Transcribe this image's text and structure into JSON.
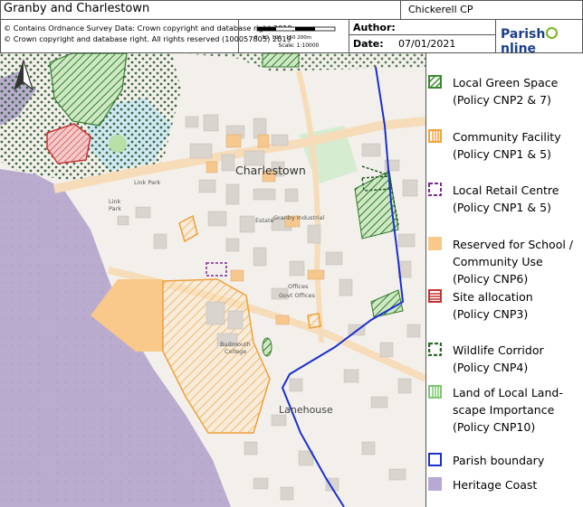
{
  "header": {
    "title": "Granby and Charlestown",
    "parish": "Chickerell CP",
    "copyright": [
      "© Contains Ordnance Survey Data: Crown copyright and database right 2019,",
      "© Crown copyright and database right. All rights reserved (100057805) 2019"
    ],
    "scale_ticks": "0   50  100   150 200m",
    "scale_caption": "Scale: 1:10000",
    "author_label": "Author:",
    "date_label": "Date:",
    "date_value": "07/01/2021",
    "logo_left": "Parish",
    "logo_right": "nline"
  },
  "map": {
    "labels": {
      "charlestown": "Charlestown",
      "lanehouse": "Lanehouse",
      "granby_industrial": "Granby Industrial",
      "estate": "Estate",
      "link_park": "Link Park",
      "link": "Link",
      "park": "Park",
      "offices": "Offices",
      "govt_offices": "Govt Offices",
      "budmouth": "Budmouth",
      "college": "College"
    }
  },
  "legend": {
    "items": [
      {
        "lines": [
          "Local Green Space",
          "(Policy CNP2 & 7)"
        ],
        "symbol": "green-hatch",
        "color": "#3a8a2e"
      },
      {
        "lines": [
          "Community Facility",
          "(Policy CNP1 & 5)"
        ],
        "symbol": "orange-vertical",
        "color": "#f4a23c"
      },
      {
        "lines": [
          "Local Retail Centre",
          "(Policy CNP1 & 5)"
        ],
        "symbol": "purple-dashed",
        "color": "#7a2a8a"
      },
      {
        "lines": [
          "Reserved for School /",
          "Community Use",
          "(Policy CNP6)"
        ],
        "symbol": "orange-fill",
        "color": "#f8c98a"
      },
      {
        "lines": [
          "Site allocation",
          "(Policy CNP3)"
        ],
        "symbol": "red-lines",
        "color": "#c83232"
      },
      {
        "lines": [
          "Wildlife Corridor",
          "(Policy CNP4)"
        ],
        "symbol": "green-dashed",
        "color": "#2a6a2a"
      },
      {
        "lines": [
          "Land of Local Land-",
          "scape Importance",
          "(Policy CNP10)"
        ],
        "symbol": "green-vertical",
        "color": "#7ec86e"
      },
      {
        "lines": [
          "Parish boundary"
        ],
        "symbol": "blue-outline",
        "color": "#1a2fd0"
      },
      {
        "lines": [
          "Heritage Coast"
        ],
        "symbol": "purple-fill",
        "color": "#b7a9d3"
      }
    ]
  }
}
